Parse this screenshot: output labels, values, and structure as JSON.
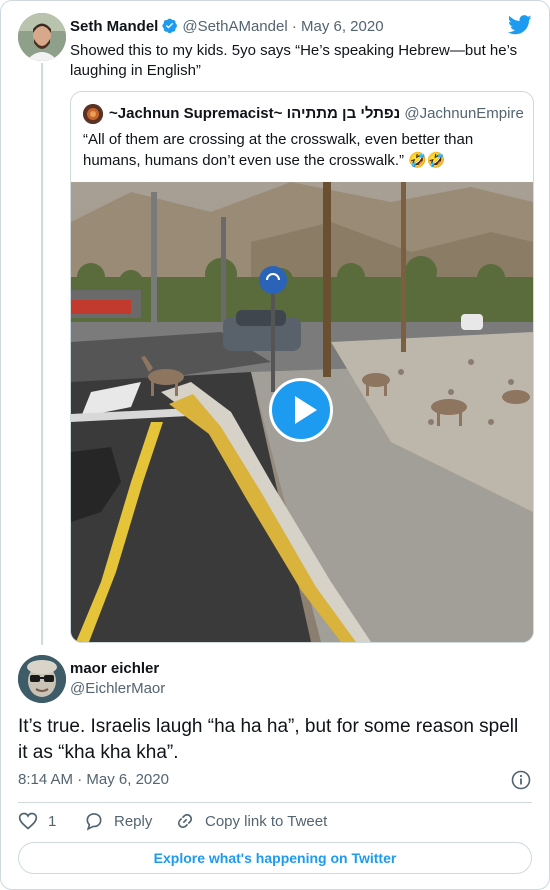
{
  "parent_tweet": {
    "author_name": "Seth Mandel",
    "handle": "@SethAMandel",
    "separator": "·",
    "date": "May 6, 2020",
    "text": "Showed this to my kids. 5yo says “He’s speaking Hebrew—but he’s laughing in English”"
  },
  "quoted_tweet": {
    "author_name": "~Jachnun Supremacist~ נפתלי בן מתתיהו",
    "handle": "@JachnunEmpire",
    "text": "“All of them are crossing at the crosswalk, even better than humans, humans don’t even use the crosswalk.” 🤣🤣"
  },
  "main_tweet": {
    "author_name": "maor eichler",
    "handle": "@EichlerMaor",
    "text": "It’s true. Israelis laugh “ha ha ha”, but for some reason spell it as “kha kha kha”.",
    "time": "8:14 AM",
    "separator": "·",
    "date": "May 6, 2020"
  },
  "actions": {
    "like_count": "1",
    "reply_label": "Reply",
    "copy_link_label": "Copy link to Tweet"
  },
  "explore_label": "Explore what's happening on Twitter",
  "icons": {
    "brand": "twitter-bird-icon",
    "verified": "verified-badge-icon",
    "play": "play-icon",
    "info": "info-icon",
    "like": "heart-icon",
    "reply": "reply-bubble-icon",
    "copy_link": "link-icon"
  },
  "colors": {
    "accent": "#1d9bf0",
    "text": "#0f1419",
    "muted": "#536471",
    "border": "#cfd9de"
  }
}
